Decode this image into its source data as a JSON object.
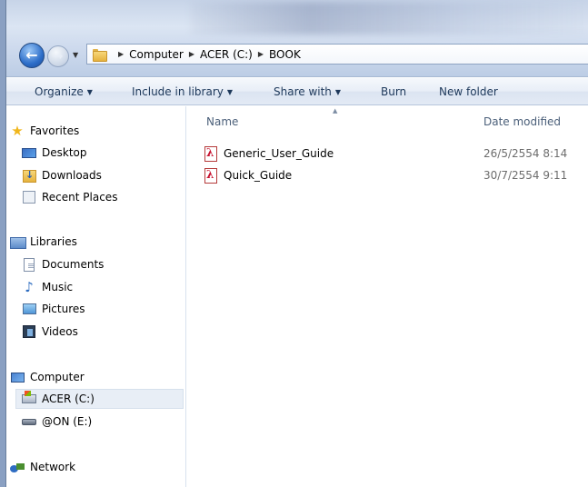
{
  "address": {
    "crumbs": [
      "Computer",
      "ACER (C:)",
      "BOOK"
    ]
  },
  "toolbar": {
    "organize": "Organize",
    "include_in_library": "Include in library",
    "share_with": "Share with",
    "burn": "Burn",
    "new_folder": "New folder"
  },
  "nav": {
    "favorites": "Favorites",
    "desktop": "Desktop",
    "downloads": "Downloads",
    "recent_places": "Recent Places",
    "libraries": "Libraries",
    "documents": "Documents",
    "music": "Music",
    "pictures": "Pictures",
    "videos": "Videos",
    "computer": "Computer",
    "acer_c": "ACER (C:)",
    "on_e": "@ON (E:)",
    "network": "Network"
  },
  "columns": {
    "name": "Name",
    "date_modified": "Date modified"
  },
  "files": [
    {
      "name": "Generic_User_Guide",
      "date": "26/5/2554 8:14"
    },
    {
      "name": "Quick_Guide",
      "date": "30/7/2554 9:11"
    }
  ],
  "icons": {
    "back": "back-arrow-icon",
    "forward": "forward-arrow-icon",
    "file": "pdf-icon"
  }
}
